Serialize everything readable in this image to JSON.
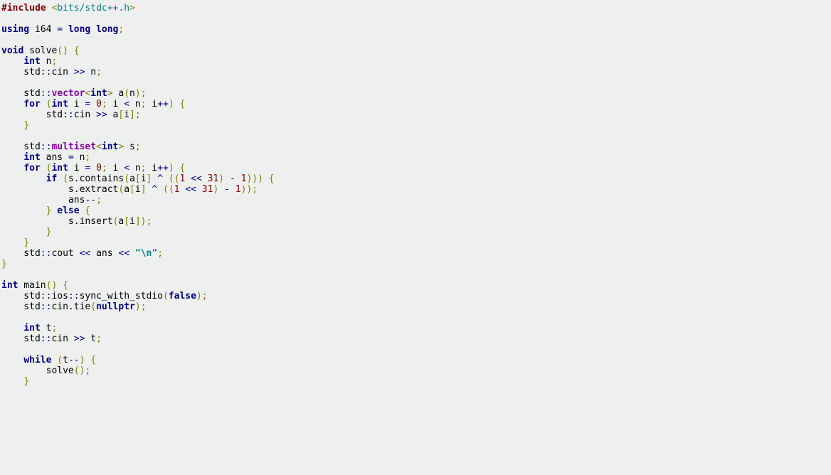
{
  "code": {
    "language": "cpp",
    "tokens": [
      [
        [
          "pp",
          "#include"
        ],
        [
          "id",
          " "
        ],
        [
          "br",
          "<"
        ],
        [
          "inc",
          "bits/stdc++.h"
        ],
        [
          "br",
          ">"
        ]
      ],
      [
        [
          "id",
          ""
        ]
      ],
      [
        [
          "kw",
          "using"
        ],
        [
          "id",
          " i64 "
        ],
        [
          "op",
          "="
        ],
        [
          "id",
          " "
        ],
        [
          "kw",
          "long long"
        ],
        [
          "br",
          ";"
        ]
      ],
      [
        [
          "id",
          ""
        ]
      ],
      [
        [
          "kw",
          "void"
        ],
        [
          "id",
          " solve"
        ],
        [
          "br",
          "()"
        ],
        [
          "id",
          " "
        ],
        [
          "br",
          "{"
        ]
      ],
      [
        [
          "id",
          "    "
        ],
        [
          "kw",
          "int"
        ],
        [
          "id",
          " n"
        ],
        [
          "br",
          ";"
        ]
      ],
      [
        [
          "id",
          "    std"
        ],
        [
          "op",
          "::"
        ],
        [
          "id",
          "cin "
        ],
        [
          "op",
          ">>"
        ],
        [
          "id",
          " n"
        ],
        [
          "br",
          ";"
        ]
      ],
      [
        [
          "id",
          ""
        ]
      ],
      [
        [
          "id",
          "    std"
        ],
        [
          "op",
          "::"
        ],
        [
          "ty",
          "vector"
        ],
        [
          "br",
          "<"
        ],
        [
          "kw",
          "int"
        ],
        [
          "br",
          ">"
        ],
        [
          "id",
          " a"
        ],
        [
          "br",
          "("
        ],
        [
          "id",
          "n"
        ],
        [
          "br",
          ")"
        ],
        [
          "br",
          ";"
        ]
      ],
      [
        [
          "id",
          "    "
        ],
        [
          "kw",
          "for"
        ],
        [
          "id",
          " "
        ],
        [
          "br",
          "("
        ],
        [
          "kw",
          "int"
        ],
        [
          "id",
          " i "
        ],
        [
          "op",
          "="
        ],
        [
          "id",
          " "
        ],
        [
          "num",
          "0"
        ],
        [
          "br",
          ";"
        ],
        [
          "id",
          " i "
        ],
        [
          "op",
          "<"
        ],
        [
          "id",
          " n"
        ],
        [
          "br",
          ";"
        ],
        [
          "id",
          " i"
        ],
        [
          "op",
          "++"
        ],
        [
          "br",
          ")"
        ],
        [
          "id",
          " "
        ],
        [
          "br",
          "{"
        ]
      ],
      [
        [
          "id",
          "        std"
        ],
        [
          "op",
          "::"
        ],
        [
          "id",
          "cin "
        ],
        [
          "op",
          ">>"
        ],
        [
          "id",
          " a"
        ],
        [
          "br",
          "["
        ],
        [
          "id",
          "i"
        ],
        [
          "br",
          "]"
        ],
        [
          "br",
          ";"
        ]
      ],
      [
        [
          "id",
          "    "
        ],
        [
          "br",
          "}"
        ]
      ],
      [
        [
          "id",
          ""
        ]
      ],
      [
        [
          "id",
          "    std"
        ],
        [
          "op",
          "::"
        ],
        [
          "ty",
          "multiset"
        ],
        [
          "br",
          "<"
        ],
        [
          "kw",
          "int"
        ],
        [
          "br",
          ">"
        ],
        [
          "id",
          " s"
        ],
        [
          "br",
          ";"
        ]
      ],
      [
        [
          "id",
          "    "
        ],
        [
          "kw",
          "int"
        ],
        [
          "id",
          " ans "
        ],
        [
          "op",
          "="
        ],
        [
          "id",
          " n"
        ],
        [
          "br",
          ";"
        ]
      ],
      [
        [
          "id",
          "    "
        ],
        [
          "kw",
          "for"
        ],
        [
          "id",
          " "
        ],
        [
          "br",
          "("
        ],
        [
          "kw",
          "int"
        ],
        [
          "id",
          " i "
        ],
        [
          "op",
          "="
        ],
        [
          "id",
          " "
        ],
        [
          "num",
          "0"
        ],
        [
          "br",
          ";"
        ],
        [
          "id",
          " i "
        ],
        [
          "op",
          "<"
        ],
        [
          "id",
          " n"
        ],
        [
          "br",
          ";"
        ],
        [
          "id",
          " i"
        ],
        [
          "op",
          "++"
        ],
        [
          "br",
          ")"
        ],
        [
          "id",
          " "
        ],
        [
          "br",
          "{"
        ]
      ],
      [
        [
          "id",
          "        "
        ],
        [
          "kw",
          "if"
        ],
        [
          "id",
          " "
        ],
        [
          "br",
          "("
        ],
        [
          "id",
          "s.contains"
        ],
        [
          "br",
          "("
        ],
        [
          "id",
          "a"
        ],
        [
          "br",
          "["
        ],
        [
          "id",
          "i"
        ],
        [
          "br",
          "]"
        ],
        [
          "id",
          " "
        ],
        [
          "op",
          "^"
        ],
        [
          "id",
          " "
        ],
        [
          "br",
          "(("
        ],
        [
          "num",
          "1"
        ],
        [
          "id",
          " "
        ],
        [
          "op",
          "<<"
        ],
        [
          "id",
          " "
        ],
        [
          "num",
          "31"
        ],
        [
          "br",
          ")"
        ],
        [
          "id",
          " "
        ],
        [
          "op",
          "-"
        ],
        [
          "id",
          " "
        ],
        [
          "num",
          "1"
        ],
        [
          "br",
          ")))"
        ],
        [
          "id",
          " "
        ],
        [
          "br",
          "{"
        ]
      ],
      [
        [
          "id",
          "            s.extract"
        ],
        [
          "br",
          "("
        ],
        [
          "id",
          "a"
        ],
        [
          "br",
          "["
        ],
        [
          "id",
          "i"
        ],
        [
          "br",
          "]"
        ],
        [
          "id",
          " "
        ],
        [
          "op",
          "^"
        ],
        [
          "id",
          " "
        ],
        [
          "br",
          "(("
        ],
        [
          "num",
          "1"
        ],
        [
          "id",
          " "
        ],
        [
          "op",
          "<<"
        ],
        [
          "id",
          " "
        ],
        [
          "num",
          "31"
        ],
        [
          "br",
          ")"
        ],
        [
          "id",
          " "
        ],
        [
          "op",
          "-"
        ],
        [
          "id",
          " "
        ],
        [
          "num",
          "1"
        ],
        [
          "br",
          "))"
        ],
        [
          "br",
          ";"
        ]
      ],
      [
        [
          "id",
          "            ans"
        ],
        [
          "op",
          "--"
        ],
        [
          "br",
          ";"
        ]
      ],
      [
        [
          "id",
          "        "
        ],
        [
          "br",
          "}"
        ],
        [
          "id",
          " "
        ],
        [
          "kw",
          "else"
        ],
        [
          "id",
          " "
        ],
        [
          "br",
          "{"
        ]
      ],
      [
        [
          "id",
          "            s.insert"
        ],
        [
          "br",
          "("
        ],
        [
          "id",
          "a"
        ],
        [
          "br",
          "["
        ],
        [
          "id",
          "i"
        ],
        [
          "br",
          "])"
        ],
        [
          "br",
          ";"
        ]
      ],
      [
        [
          "id",
          "        "
        ],
        [
          "br",
          "}"
        ]
      ],
      [
        [
          "id",
          "    "
        ],
        [
          "br",
          "}"
        ]
      ],
      [
        [
          "id",
          "    std"
        ],
        [
          "op",
          "::"
        ],
        [
          "id",
          "cout "
        ],
        [
          "op",
          "<<"
        ],
        [
          "id",
          " ans "
        ],
        [
          "op",
          "<<"
        ],
        [
          "id",
          " "
        ],
        [
          "str",
          "\"\\n\""
        ],
        [
          "br",
          ";"
        ]
      ],
      [
        [
          "br",
          "}"
        ]
      ],
      [
        [
          "id",
          ""
        ]
      ],
      [
        [
          "kw",
          "int"
        ],
        [
          "id",
          " main"
        ],
        [
          "br",
          "()"
        ],
        [
          "id",
          " "
        ],
        [
          "br",
          "{"
        ]
      ],
      [
        [
          "id",
          "    std"
        ],
        [
          "op",
          "::"
        ],
        [
          "id",
          "ios"
        ],
        [
          "op",
          "::"
        ],
        [
          "id",
          "sync_with_stdio"
        ],
        [
          "br",
          "("
        ],
        [
          "kw",
          "false"
        ],
        [
          "br",
          ")"
        ],
        [
          "br",
          ";"
        ]
      ],
      [
        [
          "id",
          "    std"
        ],
        [
          "op",
          "::"
        ],
        [
          "id",
          "cin.tie"
        ],
        [
          "br",
          "("
        ],
        [
          "kw",
          "nullptr"
        ],
        [
          "br",
          ")"
        ],
        [
          "br",
          ";"
        ]
      ],
      [
        [
          "id",
          ""
        ]
      ],
      [
        [
          "id",
          "    "
        ],
        [
          "kw",
          "int"
        ],
        [
          "id",
          " t"
        ],
        [
          "br",
          ";"
        ]
      ],
      [
        [
          "id",
          "    std"
        ],
        [
          "op",
          "::"
        ],
        [
          "id",
          "cin "
        ],
        [
          "op",
          ">>"
        ],
        [
          "id",
          " t"
        ],
        [
          "br",
          ";"
        ]
      ],
      [
        [
          "id",
          ""
        ]
      ],
      [
        [
          "id",
          "    "
        ],
        [
          "kw",
          "while"
        ],
        [
          "id",
          " "
        ],
        [
          "br",
          "("
        ],
        [
          "id",
          "t"
        ],
        [
          "op",
          "--"
        ],
        [
          "br",
          ")"
        ],
        [
          "id",
          " "
        ],
        [
          "br",
          "{"
        ]
      ],
      [
        [
          "id",
          "        solve"
        ],
        [
          "br",
          "()"
        ],
        [
          "br",
          ";"
        ]
      ],
      [
        [
          "id",
          "    "
        ],
        [
          "br",
          "}"
        ]
      ]
    ]
  }
}
